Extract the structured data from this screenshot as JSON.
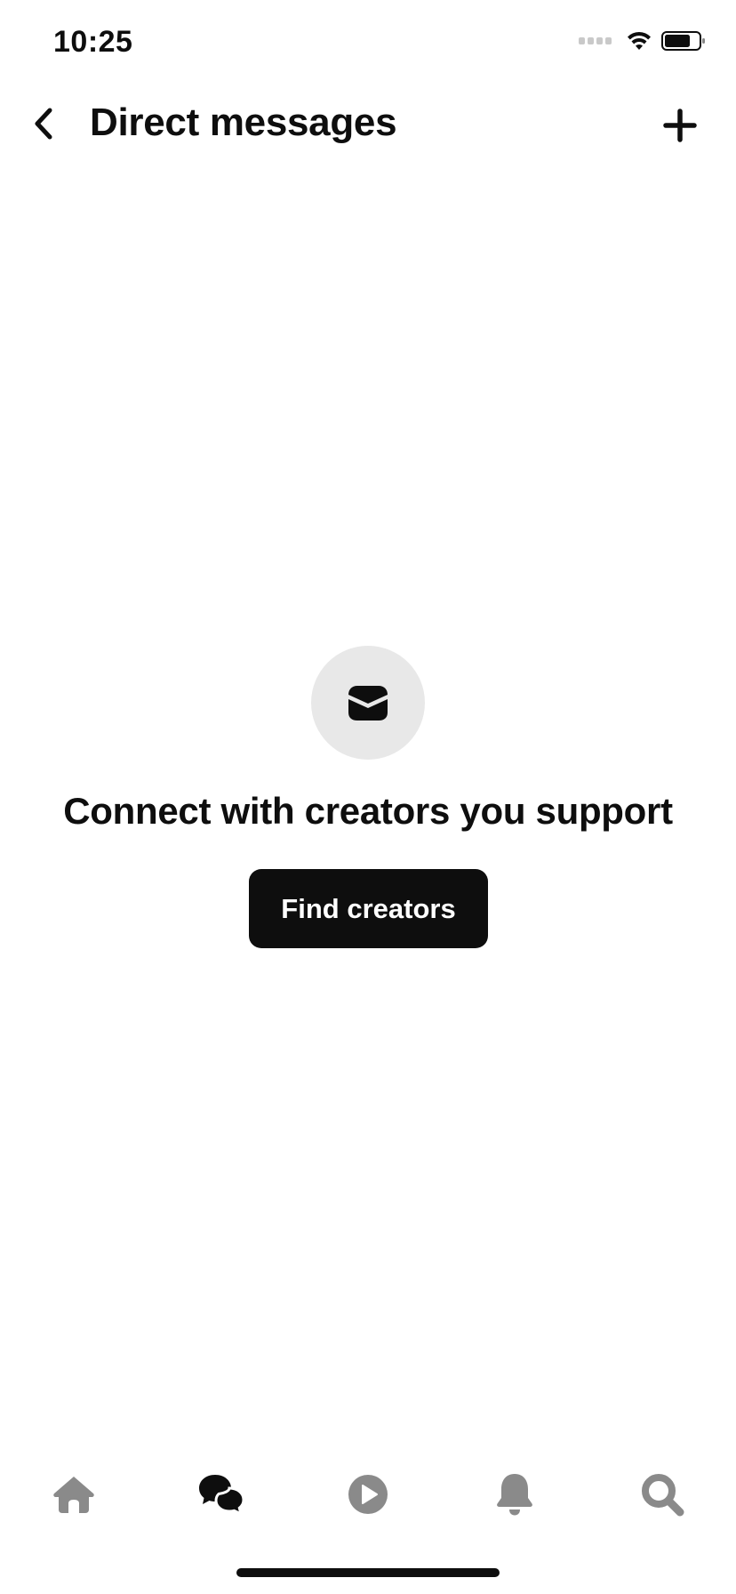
{
  "status_bar": {
    "time": "10:25"
  },
  "header": {
    "title": "Direct messages",
    "back_icon": "chevron-left-icon",
    "add_icon": "plus-icon"
  },
  "empty_state": {
    "icon": "envelope-icon",
    "heading": "Connect with creators you support",
    "button_label": "Find creators"
  },
  "tab_bar": {
    "tabs": [
      {
        "icon": "home-icon",
        "active": false
      },
      {
        "icon": "chat-bubbles-icon",
        "active": true
      },
      {
        "icon": "play-icon",
        "active": false
      },
      {
        "icon": "bell-icon",
        "active": false
      },
      {
        "icon": "search-icon",
        "active": false
      }
    ]
  },
  "colors": {
    "text": "#0e0e0e",
    "inactive_icon": "#8a8a8a",
    "icon_circle_bg": "#e8e8e8",
    "button_bg": "#0e0e0e",
    "button_text": "#ffffff"
  }
}
